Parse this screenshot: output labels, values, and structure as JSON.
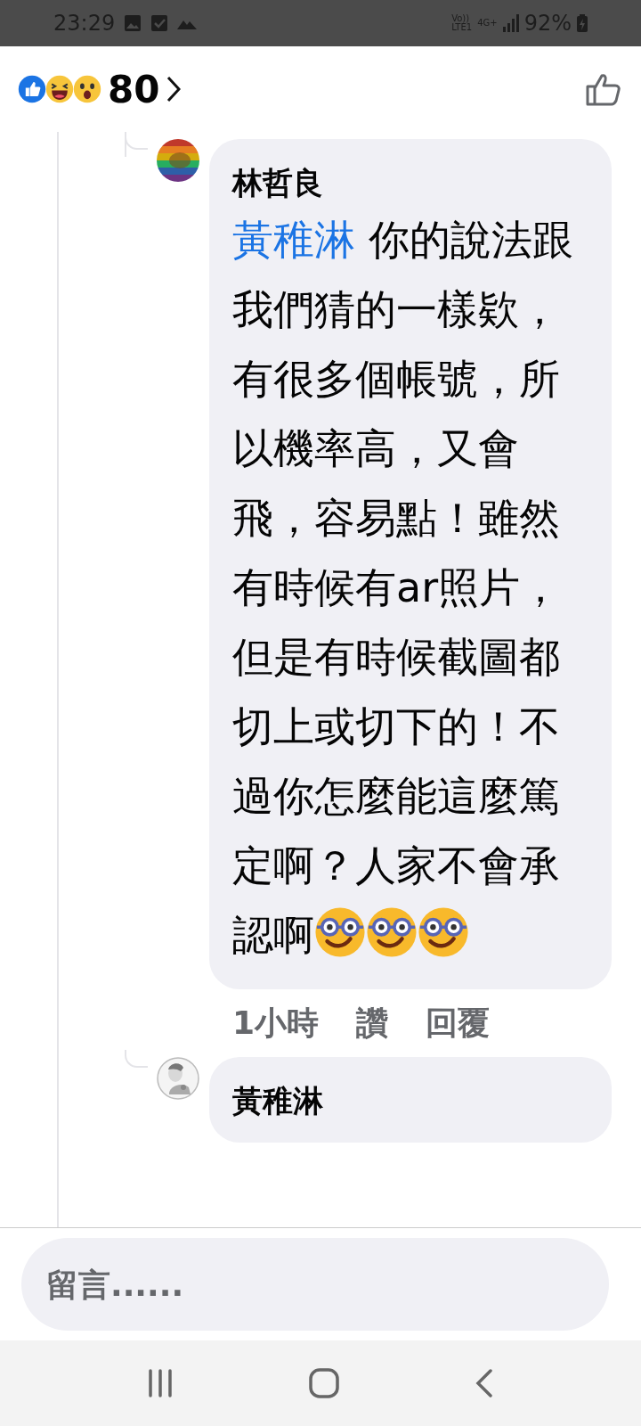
{
  "status_bar": {
    "time": "23:29",
    "volte": "Vo))",
    "lte": "LTE1",
    "network": "4G+",
    "battery": "92%"
  },
  "header": {
    "reactions": [
      {
        "kind": "like"
      },
      {
        "kind": "haha"
      },
      {
        "kind": "wow"
      }
    ],
    "count": "80"
  },
  "comments": [
    {
      "author": "林哲良",
      "mention": "黃稚淋",
      "text": "你的說法跟我們猜的一樣欵，有很多個帳號，所以機率高，又會飛，容易點！雖然有時候有ar照片，但是有時候截圖都切上或切下的！不過你怎麼能這麼篤定啊？人家不會承認啊",
      "emojis": [
        {
          "kind": "nerd-face"
        },
        {
          "kind": "nerd-face"
        },
        {
          "kind": "nerd-face"
        }
      ],
      "time": "1小時",
      "actions": [
        "讚",
        "回覆"
      ]
    },
    {
      "author": "黃稚淋"
    }
  ],
  "composer": {
    "placeholder": "留言......"
  }
}
